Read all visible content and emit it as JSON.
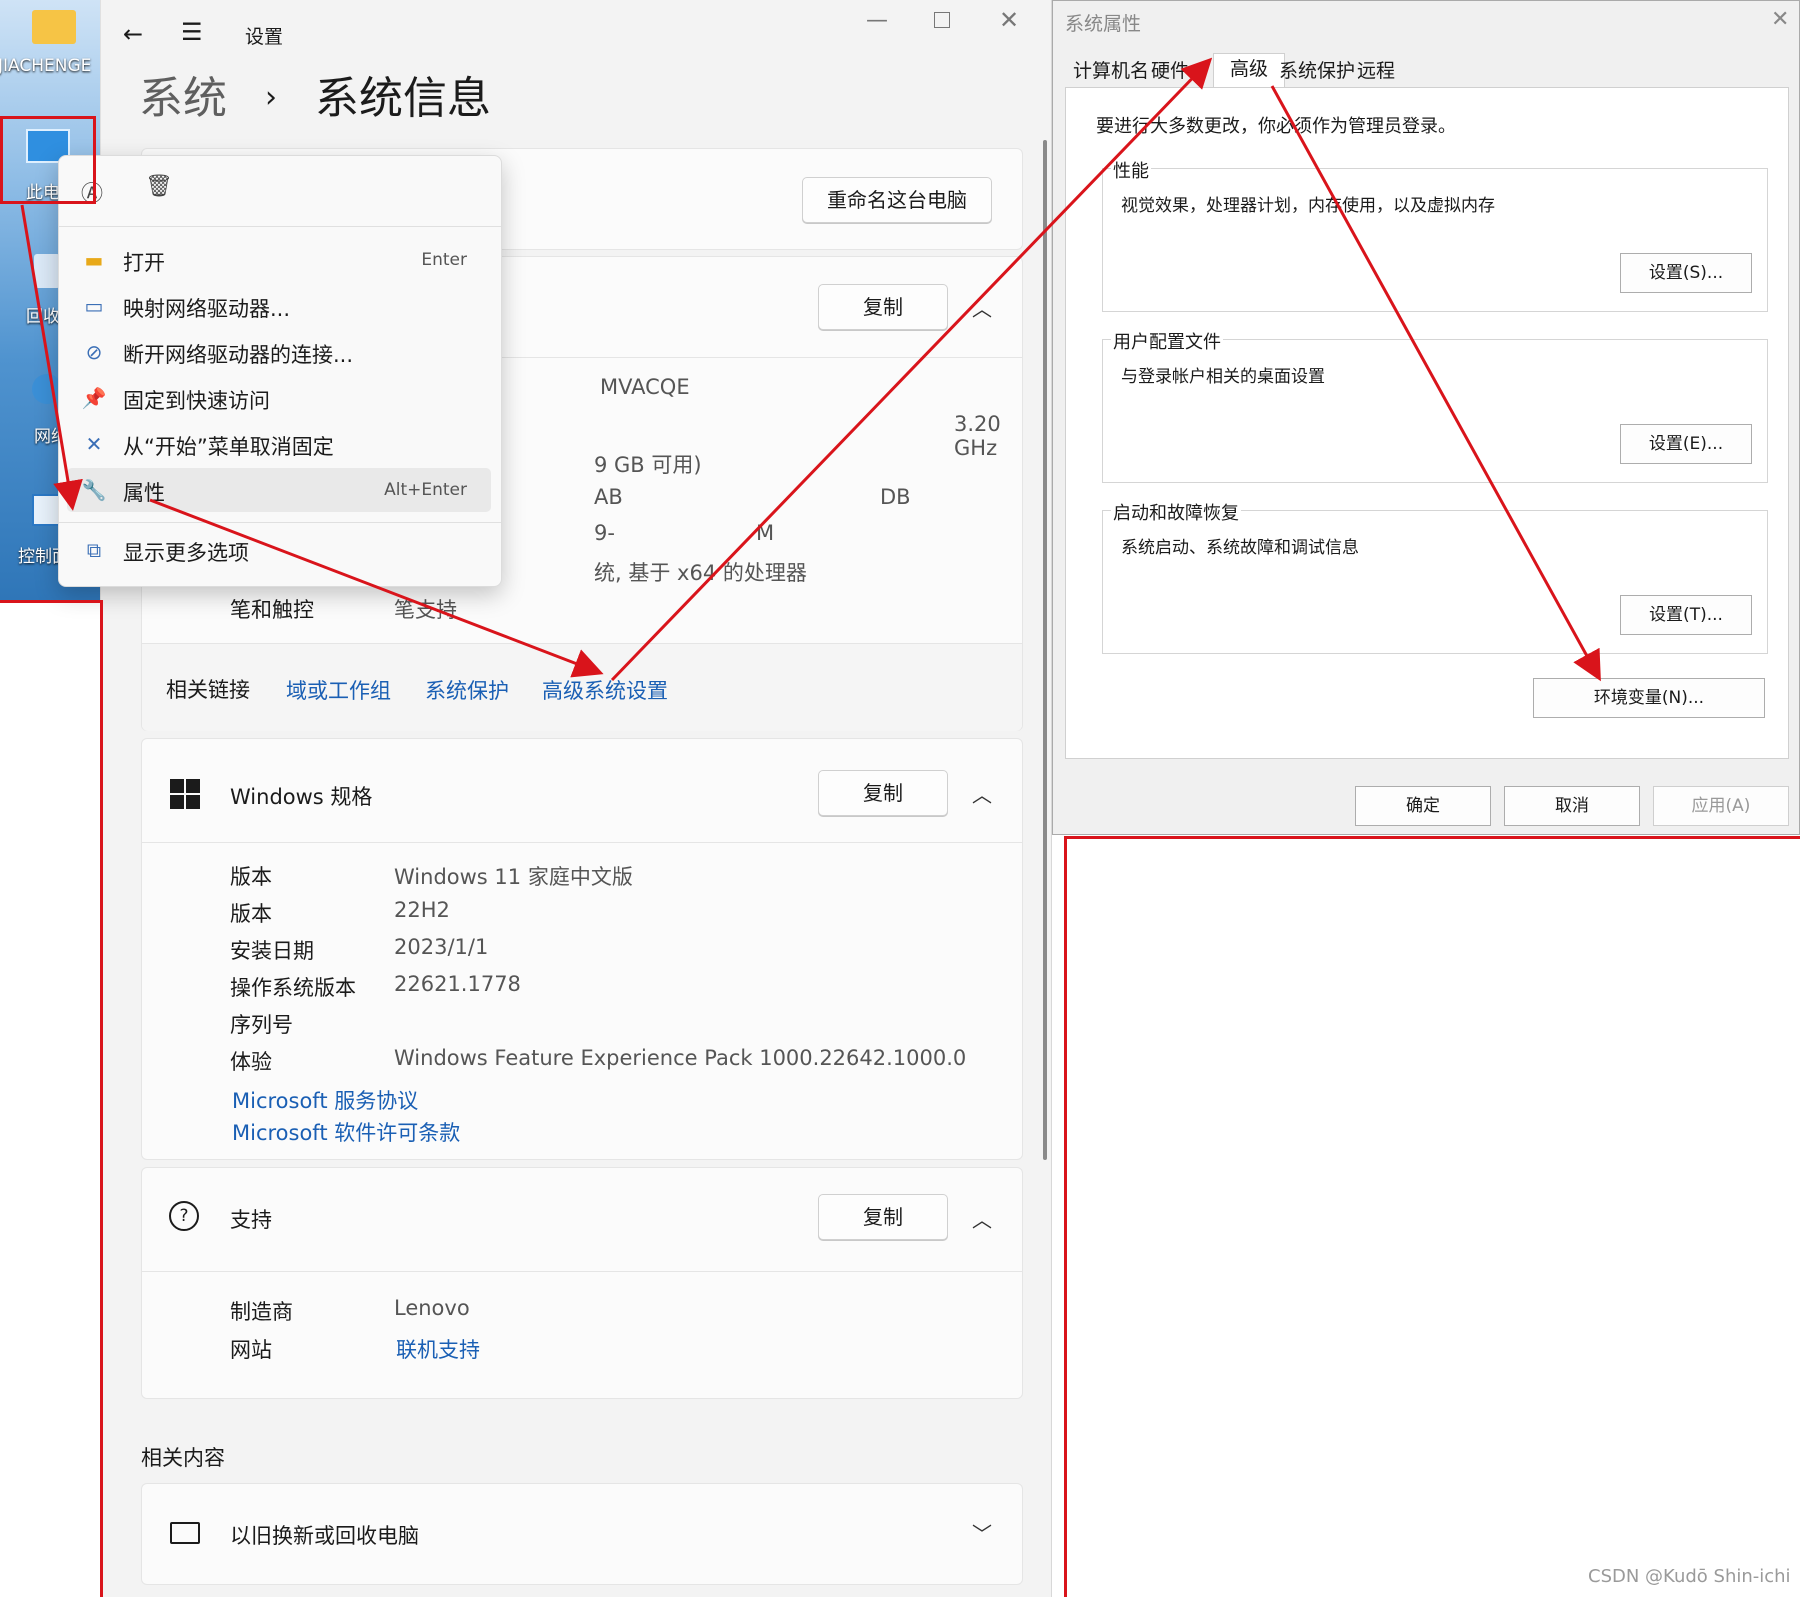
{
  "desktop": {
    "user_label": "JIACHENGE",
    "icon_labels": [
      "此电",
      "回收",
      "网络",
      "控制面"
    ]
  },
  "settings": {
    "window_title": "设置",
    "breadcrumb_parent": "系统",
    "breadcrumb_sep": "›",
    "page_title": "系统信息",
    "rename_button": "重命名这台电脑",
    "device_copy": "复制",
    "device_partial_values": [
      "MVACQE",
      "3.20 GHz",
      "9 GB 可用)",
      "AB",
      "DB",
      "9-",
      "M",
      "统, 基于 x64 的处理器"
    ],
    "pen_label": "笔和触控",
    "pen_value": "笔支持",
    "related_links_label": "相关链接",
    "related_links": [
      "域或工作组",
      "系统保护",
      "高级系统设置"
    ],
    "windows_spec": {
      "title": "Windows 规格",
      "copy": "复制",
      "rows": [
        {
          "k": "版本",
          "v": "Windows 11 家庭中文版"
        },
        {
          "k": "版本",
          "v": "22H2"
        },
        {
          "k": "安装日期",
          "v": "2023/1/1"
        },
        {
          "k": "操作系统版本",
          "v": "22621.1778"
        },
        {
          "k": "序列号",
          "v": ""
        },
        {
          "k": "体验",
          "v": "Windows Feature Experience Pack 1000.22642.1000.0"
        }
      ],
      "links": [
        "Microsoft 服务协议",
        "Microsoft 软件许可条款"
      ]
    },
    "support": {
      "title": "支持",
      "copy": "复制",
      "rows": [
        {
          "k": "制造商",
          "v": "Lenovo"
        },
        {
          "k": "网站",
          "v": "联机支持"
        }
      ]
    },
    "related_content_heading": "相关内容",
    "related_content_item": "以旧换新或回收电脑"
  },
  "context_menu": {
    "items": [
      {
        "label": "打开",
        "shortcut": "Enter",
        "icon": "folder-icon"
      },
      {
        "label": "映射网络驱动器...",
        "shortcut": "",
        "icon": "network-drive-icon"
      },
      {
        "label": "断开网络驱动器的连接...",
        "shortcut": "",
        "icon": "disconnect-drive-icon"
      },
      {
        "label": "固定到快速访问",
        "shortcut": "",
        "icon": "pin-icon"
      },
      {
        "label": "从“开始”菜单取消固定",
        "shortcut": "",
        "icon": "unpin-icon"
      },
      {
        "label": "属性",
        "shortcut": "Alt+Enter",
        "icon": "wrench-icon"
      },
      {
        "label": "显示更多选项",
        "shortcut": "",
        "icon": "more-options-icon"
      }
    ]
  },
  "system_properties": {
    "title": "系统属性",
    "tabs": [
      "计算机名",
      "硬件",
      "高级",
      "系统保护",
      "远程"
    ],
    "active_tab": "高级",
    "admin_note": "要进行大多数更改，你必须作为管理员登录。",
    "groups": [
      {
        "title": "性能",
        "desc": "视觉效果，处理器计划，内存使用，以及虚拟内存",
        "button": "设置(S)..."
      },
      {
        "title": "用户配置文件",
        "desc": "与登录帐户相关的桌面设置",
        "button": "设置(E)..."
      },
      {
        "title": "启动和故障恢复",
        "desc": "系统启动、系统故障和调试信息",
        "button": "设置(T)..."
      }
    ],
    "env_button": "环境变量(N)...",
    "ok": "确定",
    "cancel": "取消",
    "apply": "应用(A)"
  },
  "watermark": "CSDN @Kudō Shin-ichi",
  "colors": {
    "annotation_red": "#d9141b",
    "link_blue": "#1a5fb4"
  }
}
